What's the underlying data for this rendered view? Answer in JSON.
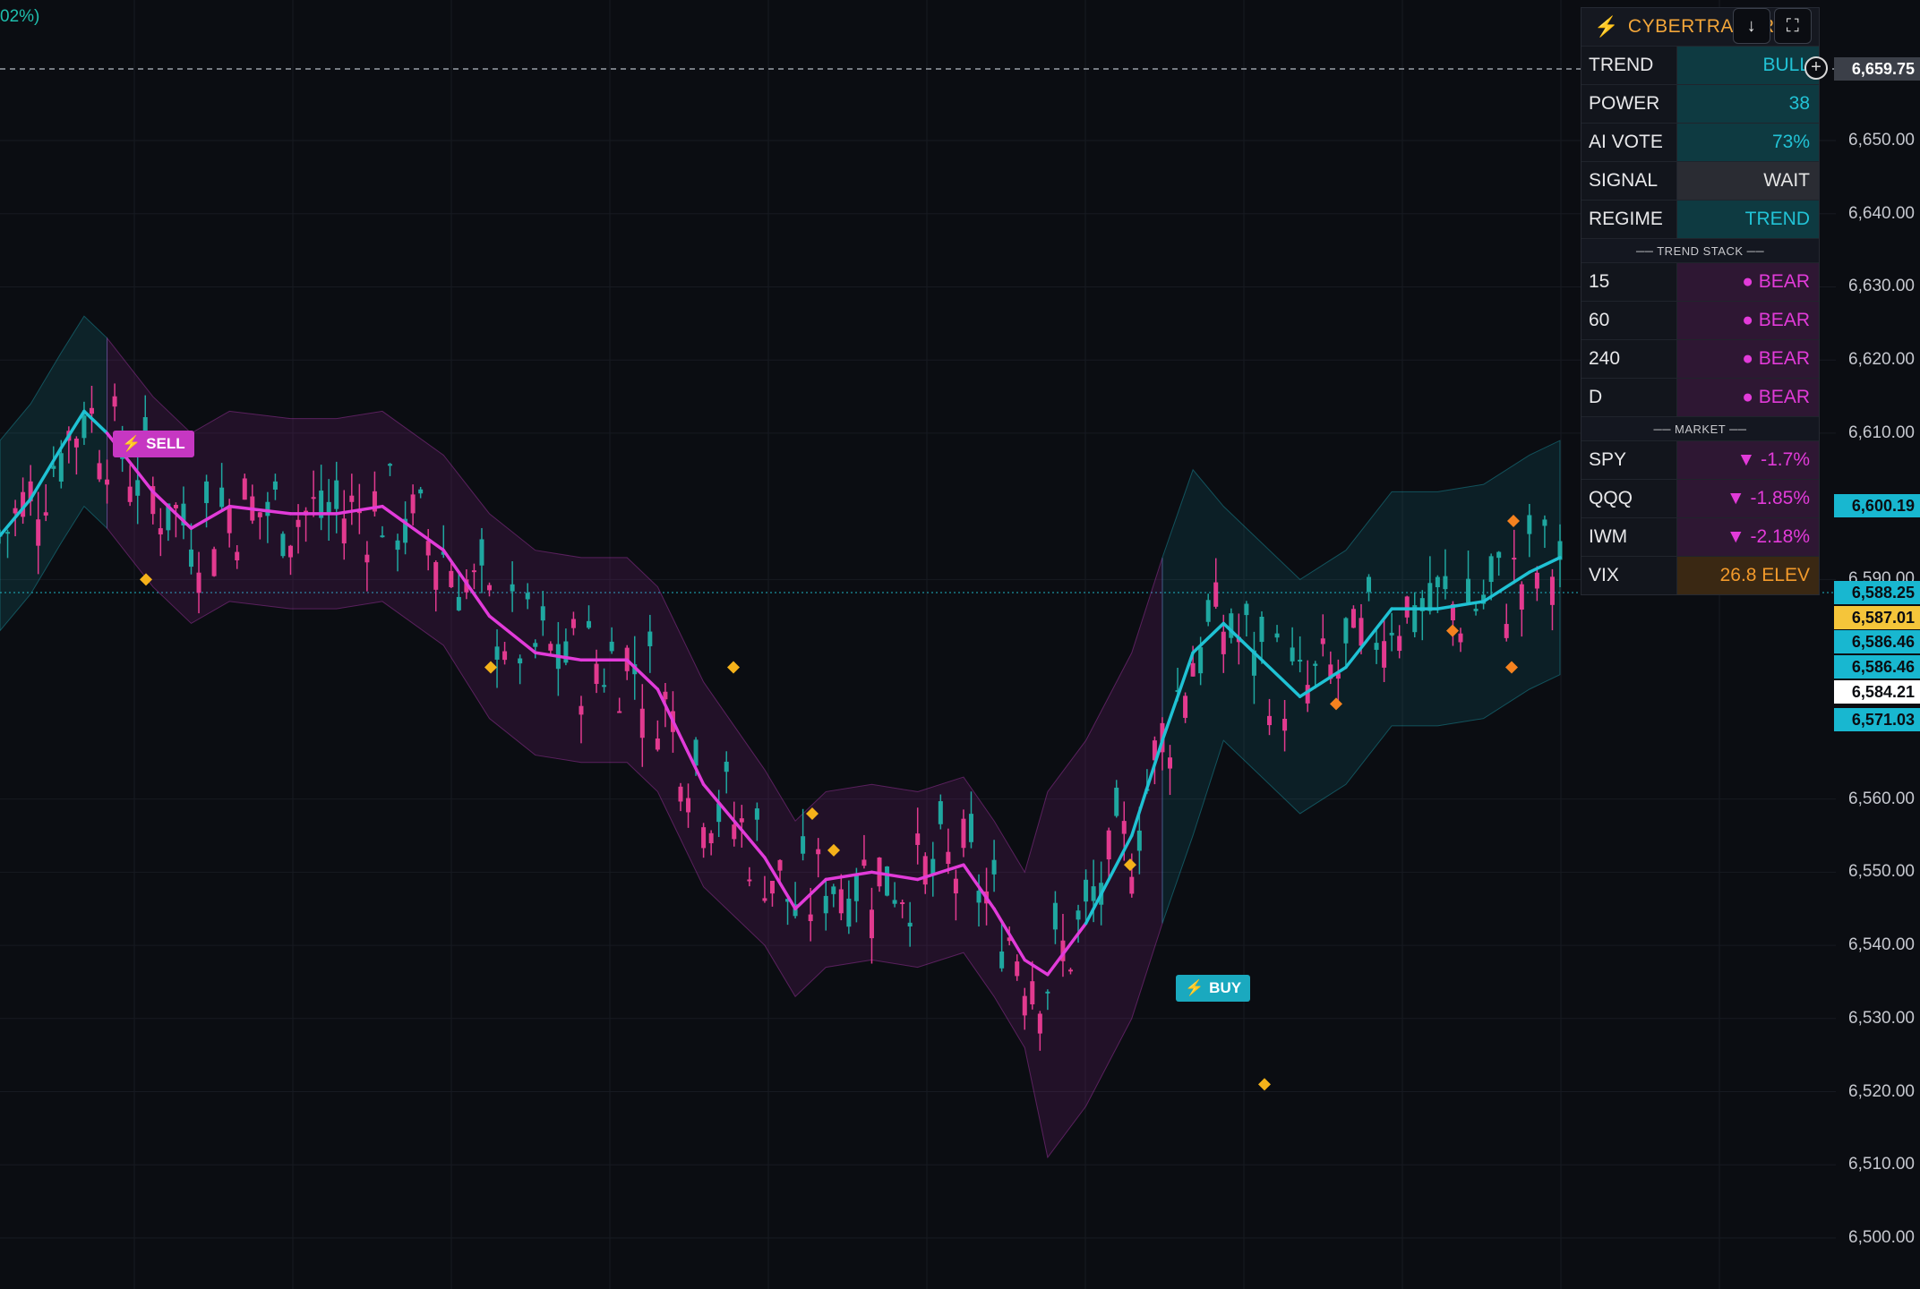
{
  "top_left_change": "02%)",
  "panel": {
    "title": "CYBERTRADER",
    "download_icon": "↓",
    "screenshot_icon": "⛶",
    "rows": [
      {
        "key": "TREND",
        "value": "BULL",
        "tone": "teal"
      },
      {
        "key": "POWER",
        "value": "38",
        "tone": "teal"
      },
      {
        "key": "AI VOTE",
        "value": "73%",
        "tone": "teal"
      },
      {
        "key": "SIGNAL",
        "value": "WAIT",
        "tone": "gray"
      },
      {
        "key": "REGIME",
        "value": "TREND",
        "tone": "teal"
      }
    ],
    "trend_stack_label": "── TREND STACK ──",
    "trend_stack": [
      {
        "key": "15",
        "value": "● BEAR"
      },
      {
        "key": "60",
        "value": "● BEAR"
      },
      {
        "key": "240",
        "value": "● BEAR"
      },
      {
        "key": "D",
        "value": "● BEAR"
      }
    ],
    "market_label": "── MARKET ──",
    "market": [
      {
        "key": "SPY",
        "value": "▼ -1.7%",
        "tone": "mag"
      },
      {
        "key": "QQQ",
        "value": "▼ -1.85%",
        "tone": "mag"
      },
      {
        "key": "IWM",
        "value": "▼ -2.18%",
        "tone": "mag"
      },
      {
        "key": "VIX",
        "value": "26.8 ELEV",
        "tone": "orange"
      }
    ]
  },
  "price_scale": {
    "ticks": [
      "6,650.00",
      "6,640.00",
      "6,630.00",
      "6,620.00",
      "6,610.00",
      "6,590.00",
      "6,560.00",
      "6,550.00",
      "6,540.00",
      "6,530.00",
      "6,520.00",
      "6,510.00",
      "6,500.00"
    ],
    "crosshair_price": "6,659.75",
    "tags": [
      {
        "label": "6,600.19",
        "bg": "#18b7d0",
        "fg": "#0b0d12"
      },
      {
        "label": "6,588.25",
        "bg": "#18b7d0",
        "fg": "#0b0d12"
      },
      {
        "label": "6,587.01",
        "bg": "#f5c53a",
        "fg": "#0b0d12"
      },
      {
        "label": "6,586.46",
        "bg": "#18b7d0",
        "fg": "#0b0d12"
      },
      {
        "label": "6,586.46",
        "bg": "#18b7d0",
        "fg": "#0b0d12"
      },
      {
        "label": "6,584.21",
        "bg": "#ffffff",
        "fg": "#0b0d12"
      },
      {
        "label": "6,571.03",
        "bg": "#18b7d0",
        "fg": "#0b0d12"
      }
    ]
  },
  "signals": {
    "sell_label": "SELL",
    "buy_label": "BUY"
  },
  "colors": {
    "bull": "#1fc2d4",
    "bear": "#e23bd9",
    "diamond": "#f5b21a",
    "background": "#0b0d12"
  },
  "chart_data": {
    "type": "candlestick",
    "ylim": [
      6500,
      6665
    ],
    "trend_line_path": [
      [
        0,
        6596
      ],
      [
        4,
        6601
      ],
      [
        8,
        6608
      ],
      [
        11,
        6613
      ],
      [
        14,
        6610
      ],
      [
        20,
        6602
      ],
      [
        25,
        6597
      ],
      [
        30,
        6600
      ],
      [
        38,
        6599
      ],
      [
        44,
        6599
      ],
      [
        50,
        6600
      ],
      [
        58,
        6594
      ],
      [
        64,
        6585
      ],
      [
        70,
        6580
      ],
      [
        76,
        6579
      ],
      [
        82,
        6579
      ],
      [
        86,
        6575
      ],
      [
        92,
        6562
      ],
      [
        100,
        6552
      ],
      [
        104,
        6545
      ],
      [
        108,
        6549
      ],
      [
        114,
        6550
      ],
      [
        120,
        6549
      ],
      [
        126,
        6551
      ],
      [
        130,
        6545
      ],
      [
        134,
        6538
      ],
      [
        137,
        6536
      ],
      [
        142,
        6543
      ],
      [
        148,
        6555
      ],
      [
        152,
        6568
      ],
      [
        156,
        6580
      ],
      [
        160,
        6584
      ],
      [
        164,
        6580
      ],
      [
        170,
        6574
      ],
      [
        176,
        6578
      ],
      [
        182,
        6586
      ],
      [
        188,
        6586
      ],
      [
        194,
        6587
      ],
      [
        200,
        6591
      ],
      [
        204,
        6593
      ]
    ],
    "diamonds": [
      6590,
      6578,
      6578,
      6558,
      6553,
      6551,
      6521,
      6573,
      6583,
      6578,
      6598
    ]
  }
}
